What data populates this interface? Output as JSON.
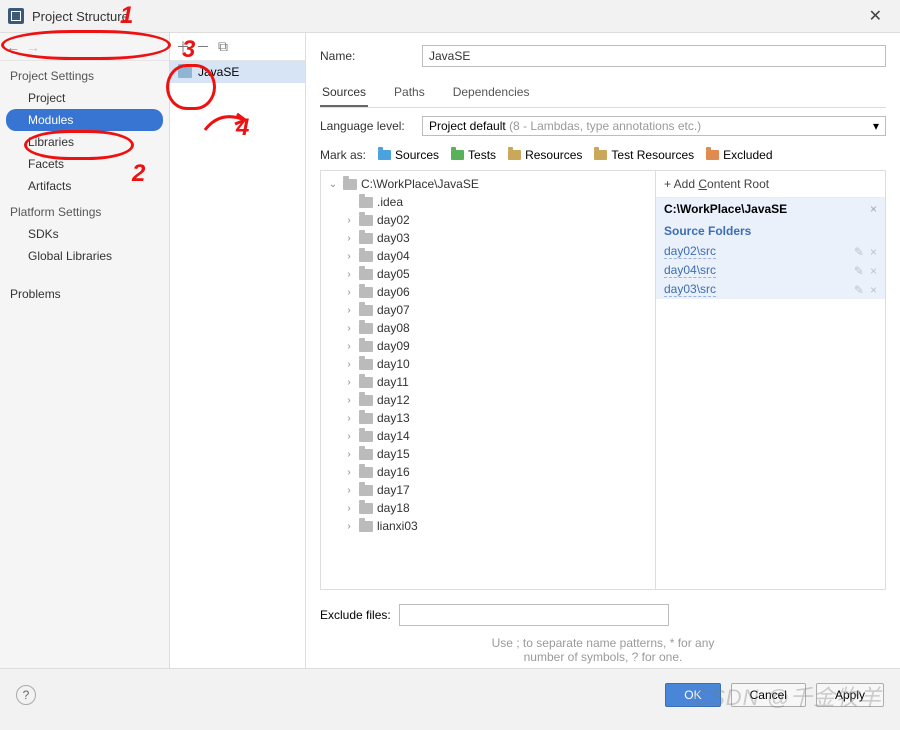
{
  "window": {
    "title": "Project Structure"
  },
  "sidebar": {
    "sections": [
      {
        "title": "Project Settings",
        "items": [
          "Project",
          "Modules",
          "Libraries",
          "Facets",
          "Artifacts"
        ],
        "selected": 1
      },
      {
        "title": "Platform Settings",
        "items": [
          "SDKs",
          "Global Libraries"
        ]
      },
      {
        "title": "",
        "items": [
          "Problems"
        ]
      }
    ]
  },
  "modules": {
    "items": [
      "JavaSE"
    ],
    "selected": 0
  },
  "form": {
    "name_label": "Name:",
    "name_value": "JavaSE",
    "tabs": [
      "Sources",
      "Paths",
      "Dependencies"
    ],
    "active_tab": 0,
    "lang_label": "Language level:",
    "lang_value": "Project default",
    "lang_hint": "(8 - Lambdas, type annotations etc.)",
    "mark_label": "Mark as:",
    "marks": [
      "Sources",
      "Tests",
      "Resources",
      "Test Resources",
      "Excluded"
    ]
  },
  "tree": {
    "root": "C:\\WorkPlace\\JavaSE",
    "children": [
      ".idea",
      "day02",
      "day03",
      "day04",
      "day05",
      "day06",
      "day07",
      "day08",
      "day09",
      "day10",
      "day11",
      "day12",
      "day13",
      "day14",
      "day15",
      "day16",
      "day17",
      "day18",
      "lianxi03"
    ]
  },
  "roots": {
    "add_label_pre": "+ Add ",
    "add_label_u": "C",
    "add_label_post": "ontent Root",
    "path": "C:\\WorkPlace\\JavaSE",
    "source_head": "Source Folders",
    "sources": [
      "day02\\src",
      "day04\\src",
      "day03\\src"
    ]
  },
  "exclude": {
    "label": "Exclude files:",
    "hint1": "Use ; to separate name patterns, * for any",
    "hint2": "number of symbols, ? for one."
  },
  "buttons": {
    "ok": "OK",
    "cancel": "Cancel",
    "apply": "Apply"
  },
  "annotations": {
    "n1": "1",
    "n2": "2",
    "n3": "3",
    "n4": "4"
  },
  "watermark": "CSDN @千金牧羊"
}
